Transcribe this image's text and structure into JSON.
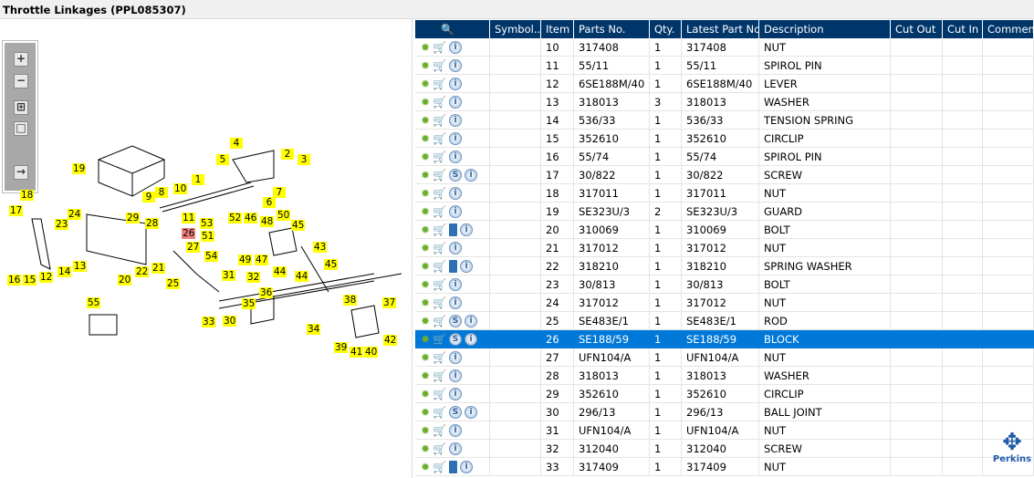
{
  "title": "Throttle Linkages (PPL085307)",
  "toolbar": {
    "zoom_in": "+",
    "zoom_out": "−",
    "fit": "⊞",
    "reset": "□",
    "export": "→"
  },
  "diagram": {
    "labels": [
      "19",
      "1",
      "4",
      "2",
      "3",
      "5",
      "6",
      "7",
      "8",
      "9",
      "10",
      "11",
      "18",
      "17",
      "24",
      "23",
      "29",
      "28",
      "26",
      "27",
      "53",
      "52",
      "46",
      "48",
      "50",
      "45",
      "51",
      "54",
      "49",
      "47",
      "44",
      "43",
      "45",
      "44",
      "14",
      "13",
      "12",
      "16",
      "15",
      "20",
      "22",
      "21",
      "25",
      "31",
      "32",
      "36",
      "35",
      "33",
      "30",
      "34",
      "38",
      "37",
      "39",
      "41",
      "40",
      "42",
      "55"
    ],
    "highlighted": "26"
  },
  "table": {
    "headers": [
      "",
      "Symbol...",
      "Item",
      "Parts No.",
      "Qty.",
      "Latest Part No.",
      "Description",
      "Cut Out",
      "Cut In",
      "Comment"
    ],
    "selected_item": "26",
    "rows": [
      {
        "item": "10",
        "part": "317408",
        "qty": "1",
        "latest": "317408",
        "desc": "NUT",
        "extra": ""
      },
      {
        "item": "11",
        "part": "55/11",
        "qty": "1",
        "latest": "55/11",
        "desc": "SPIROL PIN",
        "extra": ""
      },
      {
        "item": "12",
        "part": "6SE188M/40",
        "qty": "1",
        "latest": "6SE188M/40",
        "desc": "LEVER",
        "extra": ""
      },
      {
        "item": "13",
        "part": "318013",
        "qty": "3",
        "latest": "318013",
        "desc": "WASHER",
        "extra": ""
      },
      {
        "item": "14",
        "part": "536/33",
        "qty": "1",
        "latest": "536/33",
        "desc": "TENSION SPRING",
        "extra": ""
      },
      {
        "item": "15",
        "part": "352610",
        "qty": "1",
        "latest": "352610",
        "desc": "CIRCLIP",
        "extra": ""
      },
      {
        "item": "16",
        "part": "55/74",
        "qty": "1",
        "latest": "55/74",
        "desc": "SPIROL PIN",
        "extra": ""
      },
      {
        "item": "17",
        "part": "30/822",
        "qty": "1",
        "latest": "30/822",
        "desc": "SCREW",
        "extra": "S"
      },
      {
        "item": "18",
        "part": "317011",
        "qty": "1",
        "latest": "317011",
        "desc": "NUT",
        "extra": ""
      },
      {
        "item": "19",
        "part": "SE323U/3",
        "qty": "2",
        "latest": "SE323U/3",
        "desc": "GUARD",
        "extra": ""
      },
      {
        "item": "20",
        "part": "310069",
        "qty": "1",
        "latest": "310069",
        "desc": "BOLT",
        "extra": "book"
      },
      {
        "item": "21",
        "part": "317012",
        "qty": "1",
        "latest": "317012",
        "desc": "NUT",
        "extra": ""
      },
      {
        "item": "22",
        "part": "318210",
        "qty": "1",
        "latest": "318210",
        "desc": "SPRING WASHER",
        "extra": "book"
      },
      {
        "item": "23",
        "part": "30/813",
        "qty": "1",
        "latest": "30/813",
        "desc": "BOLT",
        "extra": ""
      },
      {
        "item": "24",
        "part": "317012",
        "qty": "1",
        "latest": "317012",
        "desc": "NUT",
        "extra": ""
      },
      {
        "item": "25",
        "part": "SE483E/1",
        "qty": "1",
        "latest": "SE483E/1",
        "desc": "ROD",
        "extra": "S"
      },
      {
        "item": "26",
        "part": "SE188/59",
        "qty": "1",
        "latest": "SE188/59",
        "desc": "BLOCK",
        "extra": "S"
      },
      {
        "item": "27",
        "part": "UFN104/A",
        "qty": "1",
        "latest": "UFN104/A",
        "desc": "NUT",
        "extra": ""
      },
      {
        "item": "28",
        "part": "318013",
        "qty": "1",
        "latest": "318013",
        "desc": "WASHER",
        "extra": ""
      },
      {
        "item": "29",
        "part": "352610",
        "qty": "1",
        "latest": "352610",
        "desc": "CIRCLIP",
        "extra": ""
      },
      {
        "item": "30",
        "part": "296/13",
        "qty": "1",
        "latest": "296/13",
        "desc": "BALL JOINT",
        "extra": "S"
      },
      {
        "item": "31",
        "part": "UFN104/A",
        "qty": "1",
        "latest": "UFN104/A",
        "desc": "NUT",
        "extra": ""
      },
      {
        "item": "32",
        "part": "312040",
        "qty": "1",
        "latest": "312040",
        "desc": "SCREW",
        "extra": ""
      },
      {
        "item": "33",
        "part": "317409",
        "qty": "1",
        "latest": "317409",
        "desc": "NUT",
        "extra": "book"
      }
    ]
  },
  "icons": {
    "gear": "✹",
    "cart": "🛒",
    "info": "i",
    "s": "S"
  },
  "logo": {
    "text": "Perkins"
  },
  "colors": {
    "header": "#00366a",
    "selected": "#0078d7",
    "callout": "#ffff00",
    "callout_highlight": "#f08080"
  }
}
